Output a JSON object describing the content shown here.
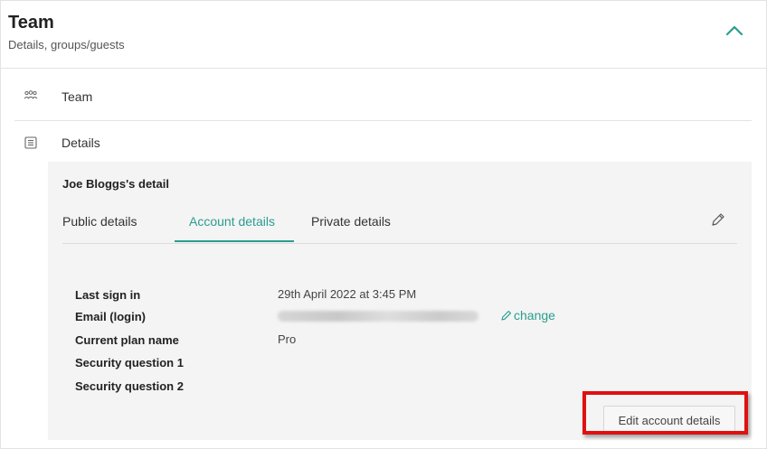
{
  "header": {
    "title": "Team",
    "subtitle": "Details, groups/guests"
  },
  "sections": {
    "team_label": "Team",
    "details_label": "Details"
  },
  "detail": {
    "title": "Joe Bloggs's detail",
    "tabs": [
      "Public details",
      "Account details",
      "Private details"
    ],
    "active_tab": "Account details",
    "fields": {
      "last_sign_in": {
        "label": "Last sign in",
        "value": "29th April 2022 at 3:45 PM"
      },
      "email": {
        "label": "Email (login)",
        "change": "change"
      },
      "plan": {
        "label": "Current plan name",
        "value": "Pro"
      },
      "security_q1": {
        "label": "Security question 1"
      },
      "security_q2": {
        "label": "Security question 2"
      }
    },
    "edit_button": "Edit account details"
  },
  "colors": {
    "accent": "#2a9d8f",
    "highlight": "#e01010"
  },
  "icons": [
    "chevron-up-icon",
    "team-icon",
    "details-list-icon",
    "pencil-icon"
  ]
}
